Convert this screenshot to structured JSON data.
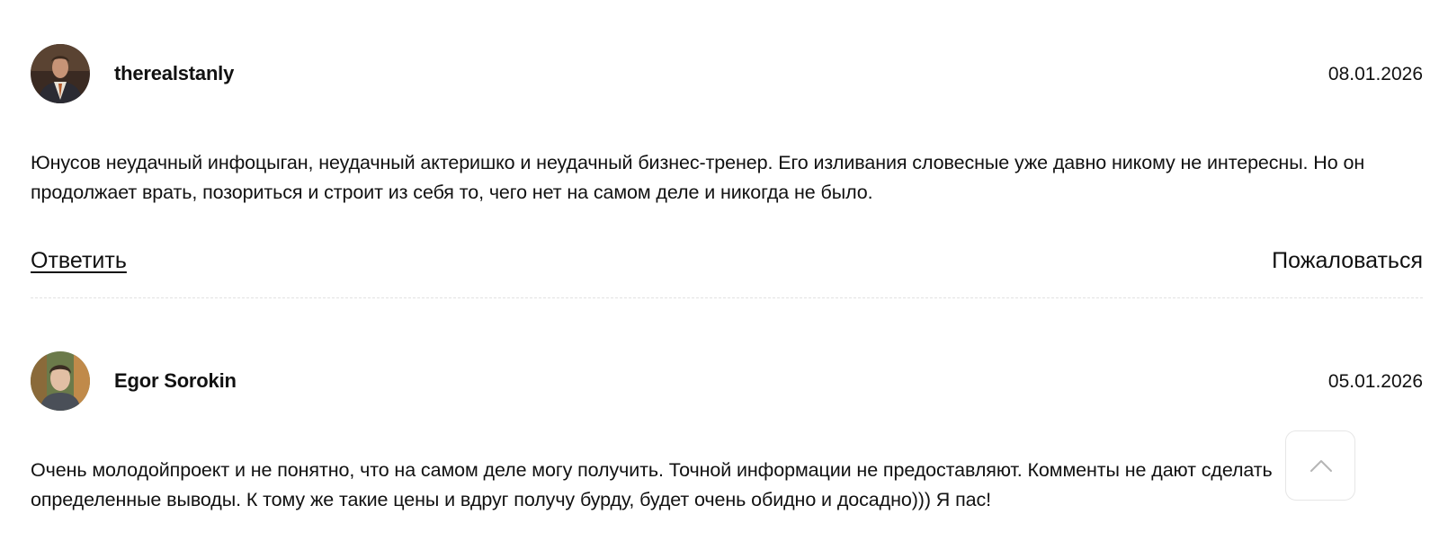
{
  "comments": [
    {
      "author": "therealstanly",
      "date": "08.01.2026",
      "avatar_icon": "user-avatar-suit",
      "text": "Юнусов неудачный инфоцыган, неудачный актеришко и неудачный бизнес-тренер. Его изливания словесные уже давно никому не интересны. Но он продолжает врать, позориться и строит из себя то, чего нет на самом деле и никогда не было.",
      "reply_label": "Ответить",
      "report_label": "Пожаловаться"
    },
    {
      "author": "Egor Sorokin",
      "date": "05.01.2026",
      "avatar_icon": "user-avatar-photo",
      "text": "Очень молодойпроект и не понятно, что на самом деле могу получить. Точной информации не предоставляют. Комменты не дают сделать определенные выводы. К тому же такие цены и вдруг получу бурду, будет очень обидно и досадно))) Я пас!"
    }
  ],
  "scroll_top_icon": "chevron-up-icon",
  "colors": {
    "text": "#111111",
    "divider": "#e2e2e2",
    "button_border": "#e6e6e6"
  }
}
